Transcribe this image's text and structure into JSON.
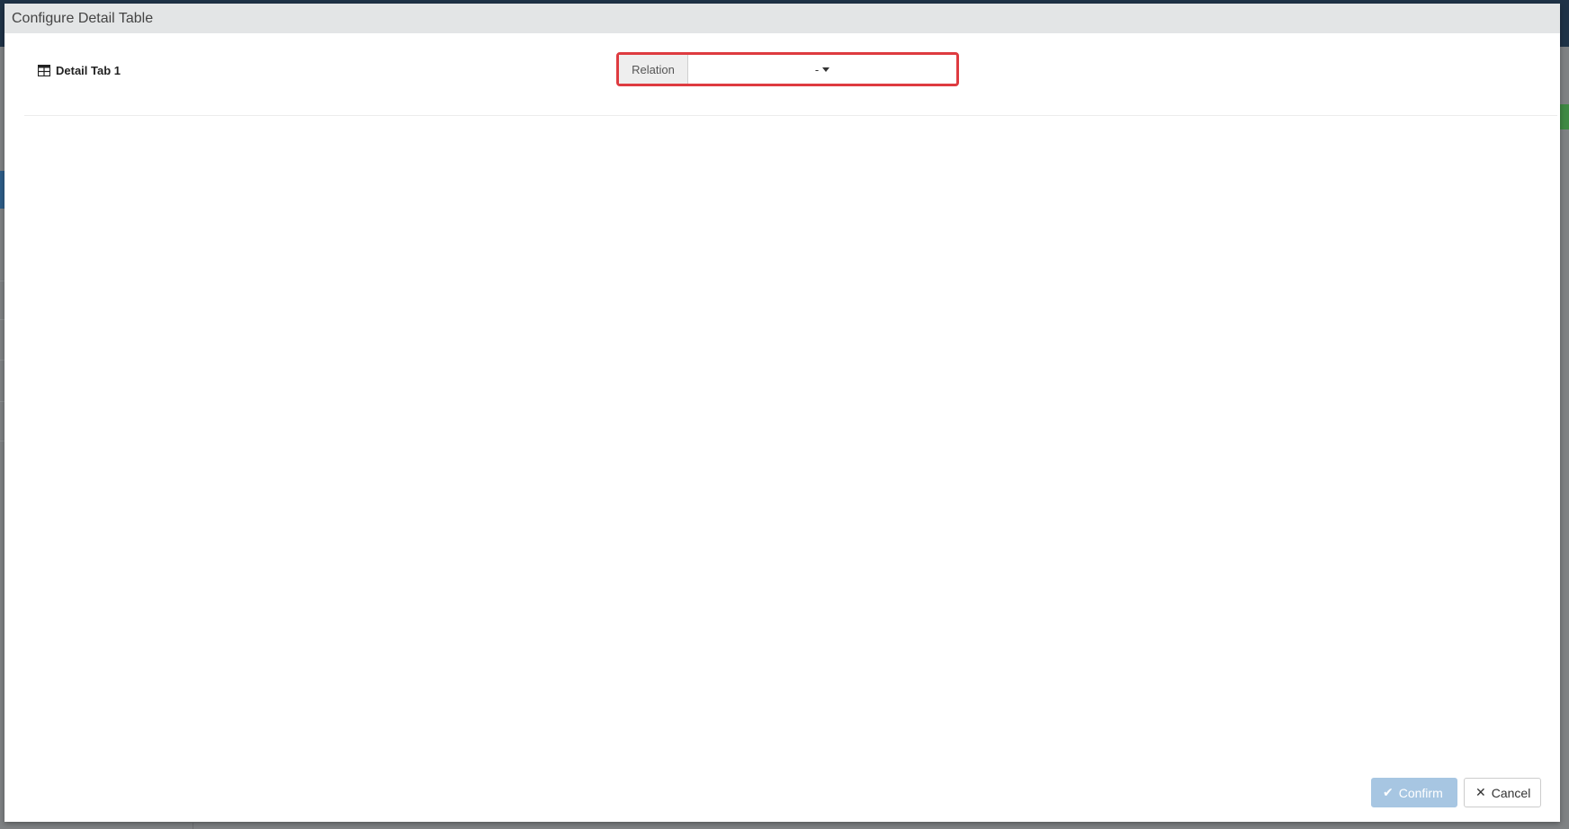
{
  "modal": {
    "title": "Configure Detail Table"
  },
  "detail": {
    "tab_label": "Detail Tab 1",
    "relation_label": "Relation",
    "relation_value": "-"
  },
  "footer": {
    "confirm_label": "Confirm",
    "cancel_label": "Cancel"
  },
  "icons": {
    "tab": "table-icon",
    "relation_dropdown": "caret-down-icon",
    "confirm": "check-icon",
    "cancel": "close-icon"
  },
  "colors": {
    "highlight_border": "#de3b40",
    "confirm_disabled": "#a7c6e2",
    "header_bg": "#e3e5e6"
  }
}
